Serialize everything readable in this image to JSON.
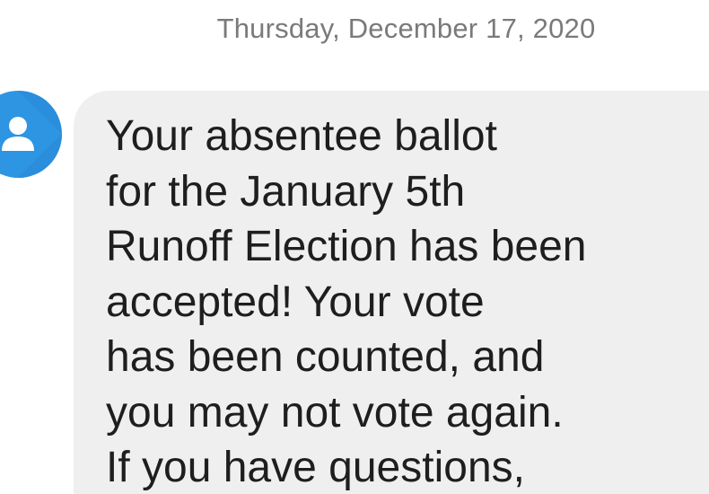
{
  "thread": {
    "date_header": "Thursday, December 17, 2020"
  },
  "message": {
    "avatar_icon": "person-icon",
    "avatar_color": "#2d95e2",
    "bubble_color": "#efefef",
    "text": "Your absentee ballot\nfor the January 5th\nRunoff Election has been\naccepted! Your vote\nhas been counted, and\nyou may not vote again.\nIf you have questions,"
  }
}
